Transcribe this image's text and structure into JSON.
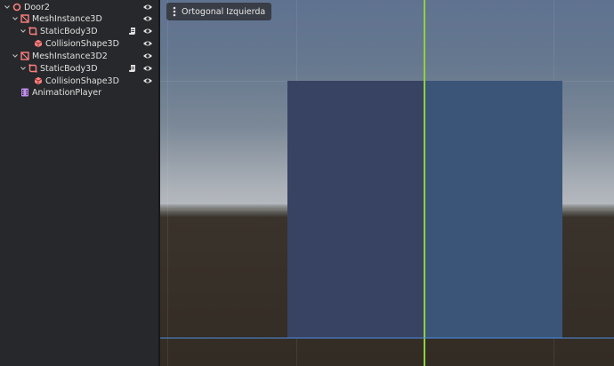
{
  "scene_tree": {
    "nodes": [
      {
        "label": "Door2",
        "icon": "node3d-icon",
        "expanded": true,
        "visible_icon": "eye-icon",
        "script": false
      },
      {
        "label": "MeshInstance3D",
        "icon": "mesh-instance-icon",
        "expanded": true,
        "visible_icon": "eye-icon",
        "script": false
      },
      {
        "label": "StaticBody3D",
        "icon": "static-body-icon",
        "expanded": true,
        "visible_icon": "eye-icon",
        "script": true
      },
      {
        "label": "CollisionShape3D",
        "icon": "collision-shape-icon",
        "expanded": false,
        "visible_icon": "eye-icon",
        "script": false
      },
      {
        "label": "MeshInstance3D2",
        "icon": "mesh-instance-icon",
        "expanded": true,
        "visible_icon": "eye-icon",
        "script": false
      },
      {
        "label": "StaticBody3D",
        "icon": "static-body-icon",
        "expanded": true,
        "visible_icon": "eye-icon",
        "script": true
      },
      {
        "label": "CollisionShape3D",
        "icon": "collision-shape-icon",
        "expanded": false,
        "visible_icon": "eye-icon",
        "script": false
      },
      {
        "label": "AnimationPlayer",
        "icon": "animation-player-icon",
        "expanded": false,
        "visible_icon": "",
        "script": false
      }
    ]
  },
  "viewport": {
    "view_label": "Ortogonal Izquierda",
    "menu_icon": "vertical-dots-icon"
  },
  "colors": {
    "node3d": "#fc7f7f",
    "mesh_instance": "#fc7f7f",
    "static_body": "#fc7f7f",
    "collision_shape": "#fc7f7f",
    "animation_player": "#c38ef1",
    "axis_y": "#8fd13d",
    "axis_z": "#4d8de6"
  }
}
